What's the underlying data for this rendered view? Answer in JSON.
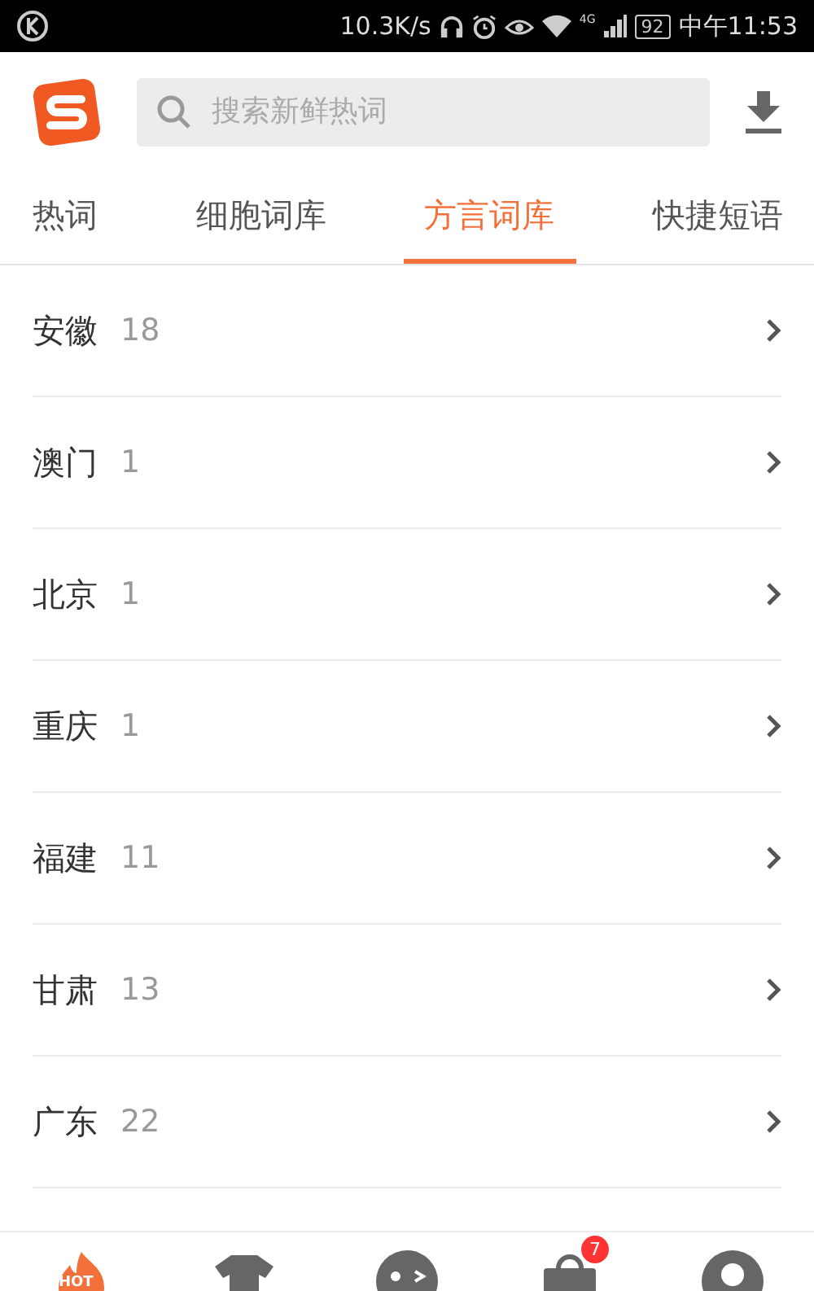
{
  "status_bar": {
    "speed": "10.3K/s",
    "network": "4G",
    "battery": "92",
    "time": "中午11:53"
  },
  "search": {
    "placeholder": "搜索新鲜热词"
  },
  "tabs": [
    {
      "label": "热词",
      "selected": false
    },
    {
      "label": "细胞词库",
      "selected": false
    },
    {
      "label": "方言词库",
      "selected": true
    },
    {
      "label": "快捷短语",
      "selected": false
    }
  ],
  "regions": [
    {
      "name": "安徽",
      "count": "18"
    },
    {
      "name": "澳门",
      "count": "1"
    },
    {
      "name": "北京",
      "count": "1"
    },
    {
      "name": "重庆",
      "count": "1"
    },
    {
      "name": "福建",
      "count": "11"
    },
    {
      "name": "甘肃",
      "count": "13"
    },
    {
      "name": "广东",
      "count": "22"
    }
  ],
  "bottom_nav": [
    {
      "kind": "hot",
      "label": "HOT",
      "selected": true
    },
    {
      "kind": "shirt",
      "selected": false
    },
    {
      "kind": "face",
      "selected": false
    },
    {
      "kind": "bag",
      "badge": "7",
      "selected": false
    },
    {
      "kind": "user",
      "selected": false
    }
  ]
}
